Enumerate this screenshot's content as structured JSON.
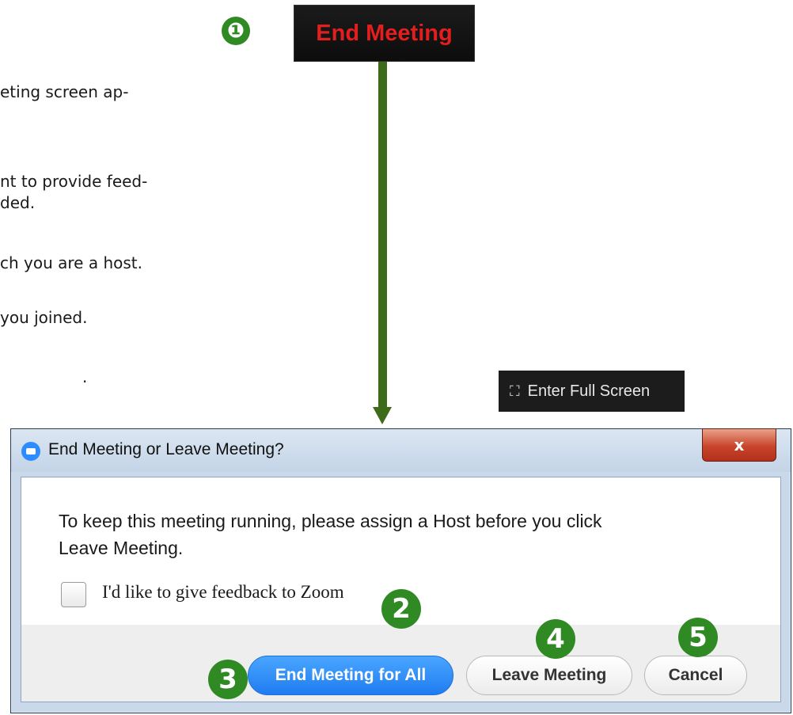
{
  "background_fragments": [
    "eting screen ap-",
    "nt to provide feed-",
    "ded.",
    "ch you are a host.",
    "you joined.",
    "."
  ],
  "callouts": {
    "one": "❶",
    "two": "2",
    "three": "3",
    "four": "4",
    "five": "5"
  },
  "toolbar": {
    "end_meeting_label": "End Meeting",
    "enter_full_screen_label": "Enter Full Screen"
  },
  "dialog": {
    "title": "End Meeting or Leave Meeting?",
    "close_label": "x",
    "message": "To keep this meeting running, please assign a Host before you click\nLeave Meeting.",
    "feedback_label": "I'd like to give feedback to Zoom",
    "buttons": {
      "end_for_all": "End Meeting for All",
      "leave": "Leave Meeting",
      "cancel": "Cancel"
    }
  },
  "colors": {
    "callout_green": "#2f8a24",
    "arrow_green": "#3e6b1a",
    "end_red": "#e21e1e",
    "primary_blue": "#1f7cf0"
  }
}
